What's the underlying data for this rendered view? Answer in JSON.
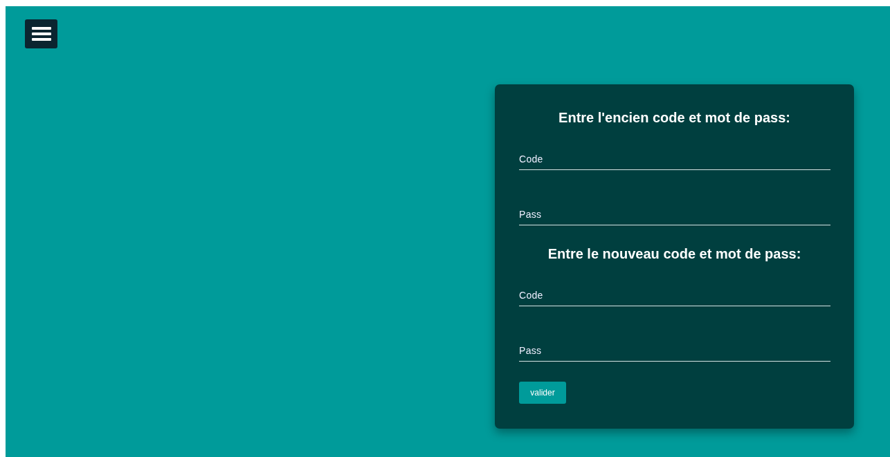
{
  "sections": [
    {
      "heading": "Entre l'encien code et mot de pass:",
      "fields": [
        {
          "placeholder": "Code"
        },
        {
          "placeholder": "Pass"
        }
      ]
    },
    {
      "heading": "Entre le nouveau code et mot de pass:",
      "fields": [
        {
          "placeholder": "Code"
        },
        {
          "placeholder": "Pass"
        }
      ]
    }
  ],
  "submit_button": "valider"
}
